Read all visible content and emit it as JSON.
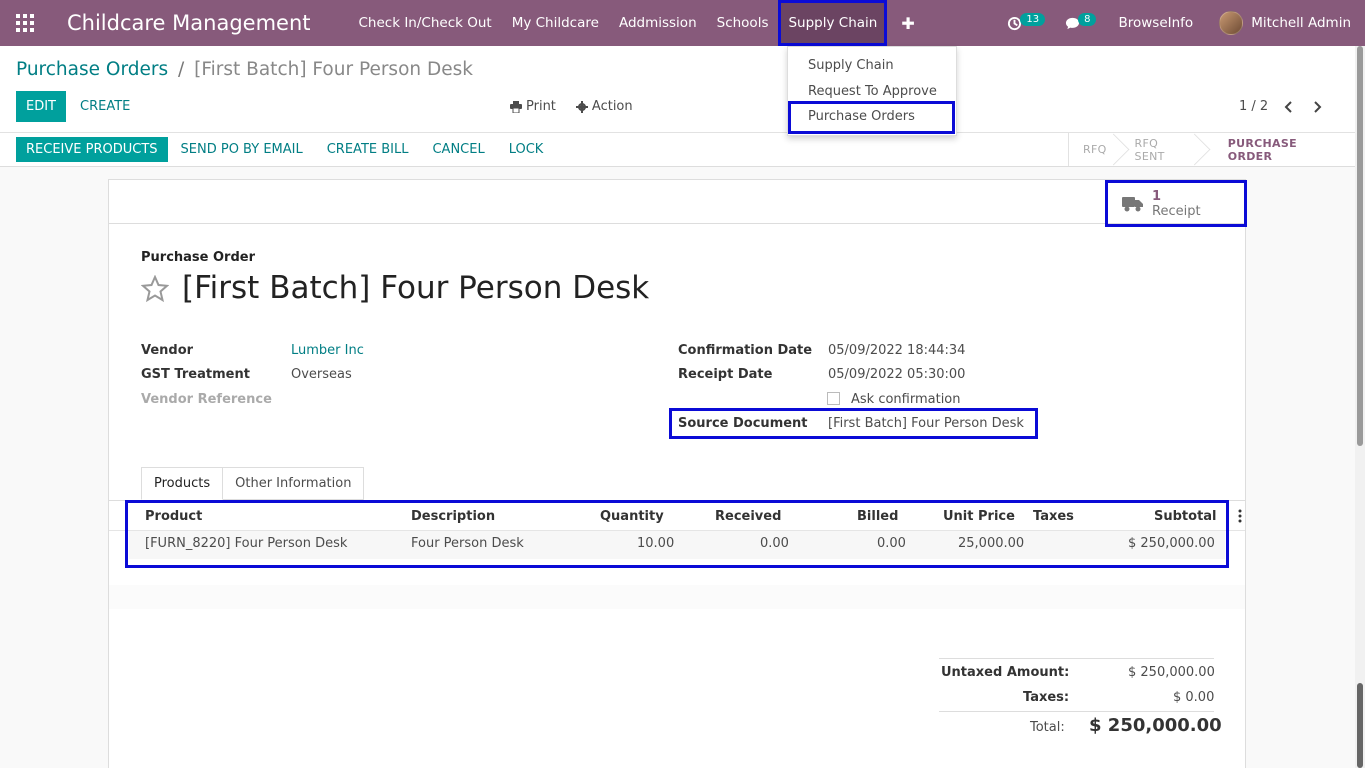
{
  "navbar": {
    "brand": "Childcare Management",
    "menu": [
      "Check In/Check Out",
      "My Childcare",
      "Addmission",
      "Schools",
      "Supply Chain"
    ],
    "activities_count": "13",
    "messages_count": "8",
    "company": "BrowseInfo",
    "user": "Mitchell Admin"
  },
  "dropdown": {
    "items": [
      "Supply Chain",
      "Request To Approve",
      "Purchase Orders"
    ]
  },
  "breadcrumb": {
    "parent": "Purchase Orders",
    "separator": "/",
    "current": "[First Batch] Four Person Desk"
  },
  "toolbar": {
    "edit": "EDIT",
    "create": "CREATE",
    "print": "Print",
    "action": "Action",
    "pager": "1 / 2"
  },
  "statusbar": {
    "buttons": [
      "RECEIVE PRODUCTS",
      "SEND PO BY EMAIL",
      "CREATE BILL",
      "CANCEL",
      "LOCK"
    ],
    "stages": [
      "RFQ",
      "RFQ SENT",
      "PURCHASE ORDER"
    ],
    "current_stage": "PURCHASE ORDER"
  },
  "smart_button": {
    "count": "1",
    "label": "Receipt"
  },
  "form": {
    "doc_type": "Purchase Order",
    "title": "[First Batch] Four Person Desk",
    "vendor_label": "Vendor",
    "vendor_value": "Lumber Inc",
    "gst_label": "GST Treatment",
    "gst_value": "Overseas",
    "vendor_ref_label": "Vendor Reference",
    "confirmation_label": "Confirmation Date",
    "confirmation_value": "05/09/2022 18:44:34",
    "receipt_label": "Receipt Date",
    "receipt_value": "05/09/2022 05:30:00",
    "ask_confirmation": "Ask confirmation",
    "source_label": "Source Document",
    "source_value": "[First Batch] Four Person Desk"
  },
  "tabs": [
    "Products",
    "Other Information"
  ],
  "order_lines": {
    "columns": [
      "Product",
      "Description",
      "Quantity",
      "Received",
      "Billed",
      "Unit Price",
      "Taxes",
      "Subtotal"
    ],
    "rows": [
      {
        "product": "[FURN_8220] Four Person Desk",
        "description": "Four Person Desk",
        "quantity": "10.00",
        "received": "0.00",
        "billed": "0.00",
        "unit_price": "25,000.00",
        "taxes": "",
        "subtotal": "$ 250,000.00"
      }
    ]
  },
  "totals": {
    "untaxed_label": "Untaxed Amount:",
    "untaxed_value": "$ 250,000.00",
    "taxes_label": "Taxes:",
    "taxes_value": "$ 0.00",
    "total_label": "Total:",
    "total_value": "$ 250,000.00"
  },
  "colors": {
    "navbar": "#875a7b",
    "primary": "#00a09d",
    "link": "#017e84",
    "highlight": "#0b0bd6"
  }
}
